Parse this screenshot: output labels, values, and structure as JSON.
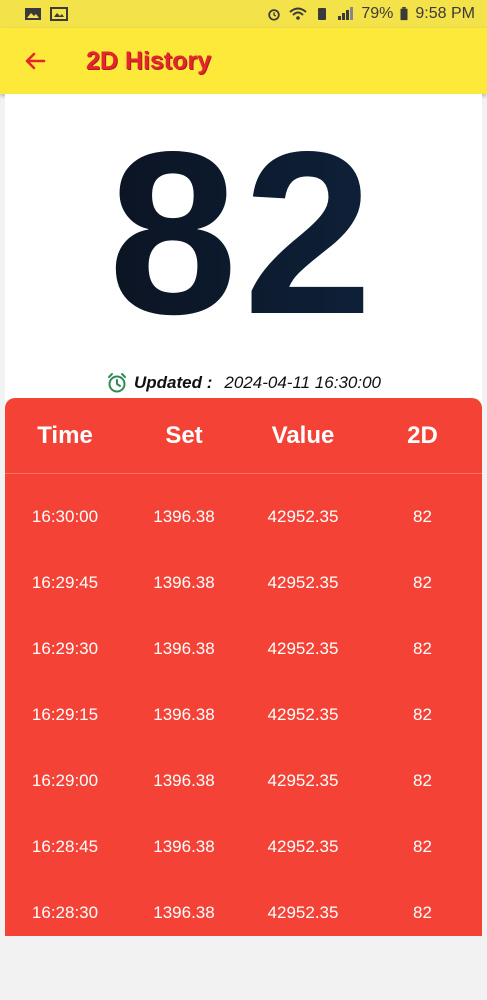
{
  "status_bar": {
    "battery": "79%",
    "time": "9:58 PM"
  },
  "app_bar": {
    "title": "2D History",
    "back_icon": "arrow-left-icon"
  },
  "result": {
    "number": "82",
    "updated_label": "Updated :",
    "updated_value": "2024-04-11 16:30:00",
    "clock_icon": "alarm-clock-icon"
  },
  "table": {
    "headers": [
      "Time",
      "Set",
      "Value",
      "2D"
    ],
    "rows": [
      [
        "16:30:00",
        "1396.38",
        "42952.35",
        "82"
      ],
      [
        "16:29:45",
        "1396.38",
        "42952.35",
        "82"
      ],
      [
        "16:29:30",
        "1396.38",
        "42952.35",
        "82"
      ],
      [
        "16:29:15",
        "1396.38",
        "42952.35",
        "82"
      ],
      [
        "16:29:00",
        "1396.38",
        "42952.35",
        "82"
      ],
      [
        "16:28:45",
        "1396.38",
        "42952.35",
        "82"
      ],
      [
        "16:28:30",
        "1396.38",
        "42952.35",
        "82"
      ]
    ]
  },
  "colors": {
    "app_bar": "#fde93a",
    "title": "#e3262c",
    "table_bg": "#f44336"
  }
}
